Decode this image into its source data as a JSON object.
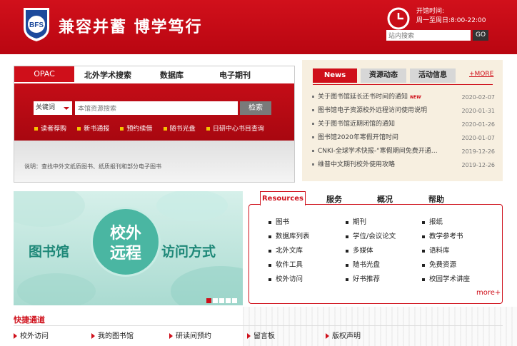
{
  "header": {
    "logo_text": "BFS",
    "motto": "兼容并蓄 博学笃行",
    "hours_title": "开馆时间:",
    "hours_value": "周一至周日:8:00-22:00",
    "search_placeholder": "站内搜索",
    "go_label": "GO"
  },
  "opac": {
    "tabs": [
      "OPAC",
      "北外学术搜索",
      "数据库",
      "电子期刊"
    ],
    "select_value": "关键词",
    "search_placeholder": "本馆资源搜索",
    "search_button": "检索",
    "links": [
      "读者荐购",
      "新书通报",
      "预约续借",
      "随书光盘",
      "日研中心书目查询"
    ],
    "note": "说明：查找中外文纸质图书、纸质报刊和部分电子图书"
  },
  "news": {
    "tabs": [
      "News",
      "资源动态",
      "活动信息"
    ],
    "more": "+MORE",
    "new_badge": "NEW",
    "items": [
      {
        "title": "关于图书馆延长还书时间的通知",
        "date": "2020-02-07"
      },
      {
        "title": "图书馆电子资源校外远程访问使用说明",
        "date": "2020-01-31"
      },
      {
        "title": "关于图书馆近期闭馆的通知",
        "date": "2020-01-26"
      },
      {
        "title": "图书馆2020年寒假开馆时间",
        "date": "2020-01-07"
      },
      {
        "title": "CNKI-全球学术快报-“寒假期间免费开通…",
        "date": "2019-12-26"
      },
      {
        "title": "维普中文期刊校外使用攻略",
        "date": "2019-12-26"
      }
    ]
  },
  "banner": {
    "left_text": "图书馆",
    "center_line1": "校外",
    "center_line2": "远程",
    "right_text": "访问方式"
  },
  "resources": {
    "tabs": [
      "Resources",
      "服务",
      "概况",
      "帮助"
    ],
    "items": [
      "图书",
      "期刊",
      "报纸",
      "数据库列表",
      "学位/会议论文",
      "教学参考书",
      "北外文库",
      "多媒体",
      "语料库",
      "软件工具",
      "随书光盘",
      "免费资源",
      "校外访问",
      "好书推荐",
      "校园学术讲座"
    ],
    "more": "more+"
  },
  "quick": {
    "title": "快捷通道",
    "items": [
      "校外访问",
      "我的图书馆",
      "研读间预约",
      "留言板",
      "版权声明"
    ]
  },
  "colors": {
    "brand_red": "#cf0f1a",
    "banner_teal": "#4ab6a2"
  }
}
